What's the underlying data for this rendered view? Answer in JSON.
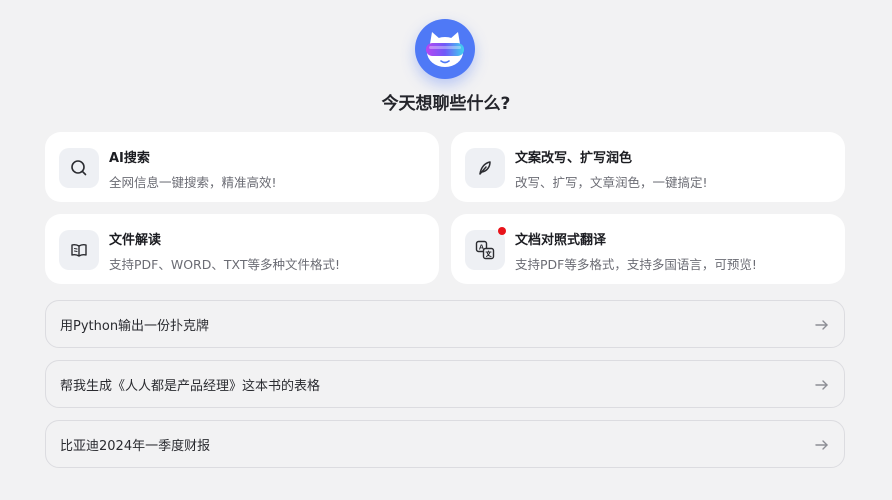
{
  "header": {
    "logo_icon": "mascot-vr-goggles-icon",
    "title": "今天想聊些什么?"
  },
  "feature_cards": [
    {
      "icon": "search-icon",
      "title": "AI搜索",
      "description": "全网信息一键搜索，精准高效!"
    },
    {
      "icon": "quill-icon",
      "title": "文案改写、扩写润色",
      "description": "改写、扩写，文章润色，一键搞定!"
    },
    {
      "icon": "open-book-icon",
      "title": "文件解读",
      "description": "支持PDF、WORD、TXT等多种文件格式!"
    },
    {
      "icon": "translate-icon",
      "title": "文档对照式翻译",
      "description": "支持PDF等多格式，支持多国语言，可预览!",
      "badge_color": "#e8131a"
    }
  ],
  "suggestions": [
    {
      "text": "用Python输出一份扑克牌",
      "icon": "arrow-right-icon"
    },
    {
      "text": "帮我生成《人人都是产品经理》这本书的表格",
      "icon": "arrow-right-icon"
    },
    {
      "text": "比亚迪2024年一季度财报",
      "icon": "arrow-right-icon"
    }
  ],
  "colors": {
    "background": "#f2f2f3",
    "card": "#ffffff",
    "accent_blue": "#4f79f6",
    "badge_red": "#e8131a"
  }
}
